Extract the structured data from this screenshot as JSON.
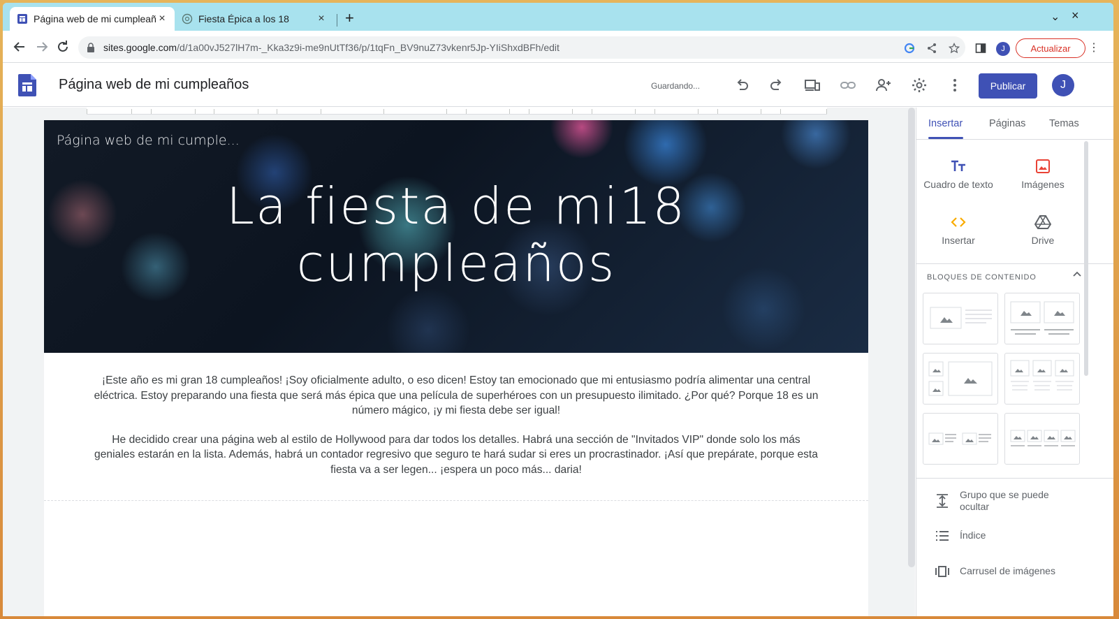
{
  "browser": {
    "tabs": [
      {
        "title": "Página web de mi cumpleaños",
        "active": true
      },
      {
        "title": "Fiesta Épica a los 18",
        "active": false
      }
    ],
    "url_host": "sites.google.com",
    "url_path": "/d/1a00vJ527lH7m-_Kka3z9i-me9nUtTf36/p/1tqFn_BV9nuZ73vkenr5Jp-YIiShxdBFh/edit",
    "profile_initial": "J",
    "update_label": "Actualizar",
    "new_tab_symbol": "+",
    "close_symbol": "×"
  },
  "app": {
    "site_title": "Página web de mi cumpleaños",
    "save_status": "Guardando...",
    "publish_label": "Publicar",
    "avatar_initial": "J",
    "accent_color": "#3f51b5"
  },
  "page": {
    "header_site_name": "Página web de mi cumple...",
    "hero_title_line1": "La fiesta de mi18",
    "hero_title_line2": "cumpleaños",
    "paragraph1": "¡Este año es mi gran 18 cumpleaños! ¡Soy oficialmente adulto, o eso dicen! Estoy tan emocionado que mi entusiasmo podría alimentar una central eléctrica. Estoy preparando una fiesta que será más épica que una película de superhéroes con un presupuesto ilimitado. ¿Por qué? Porque 18 es un número mágico, ¡y mi fiesta debe ser igual!",
    "paragraph2": "He decidido crear una página web al estilo de Hollywood para dar todos los detalles. Habrá una sección de \"Invitados VIP\" donde solo los más geniales estarán en la lista. Además, habrá un contador regresivo que seguro te hará sudar si eres un procrastinador. ¡Así que prepárate, porque esta fiesta va a ser legen... ¡espera un poco más... daria!"
  },
  "panel": {
    "tabs": [
      "Insertar",
      "Páginas",
      "Temas"
    ],
    "insert_items": [
      {
        "label": "Cuadro de texto",
        "icon": "text-box-icon"
      },
      {
        "label": "Imágenes",
        "icon": "image-icon"
      },
      {
        "label": "Insertar",
        "icon": "embed-icon"
      },
      {
        "label": "Drive",
        "icon": "drive-icon"
      }
    ],
    "blocks_title": "BLOQUES DE CONTENIDO",
    "list_items": [
      {
        "label": "Grupo que se puede ocultar",
        "icon": "collapsible-group-icon"
      },
      {
        "label": "Índice",
        "icon": "table-of-contents-icon"
      },
      {
        "label": "Carrusel de imágenes",
        "icon": "carousel-icon"
      }
    ]
  }
}
